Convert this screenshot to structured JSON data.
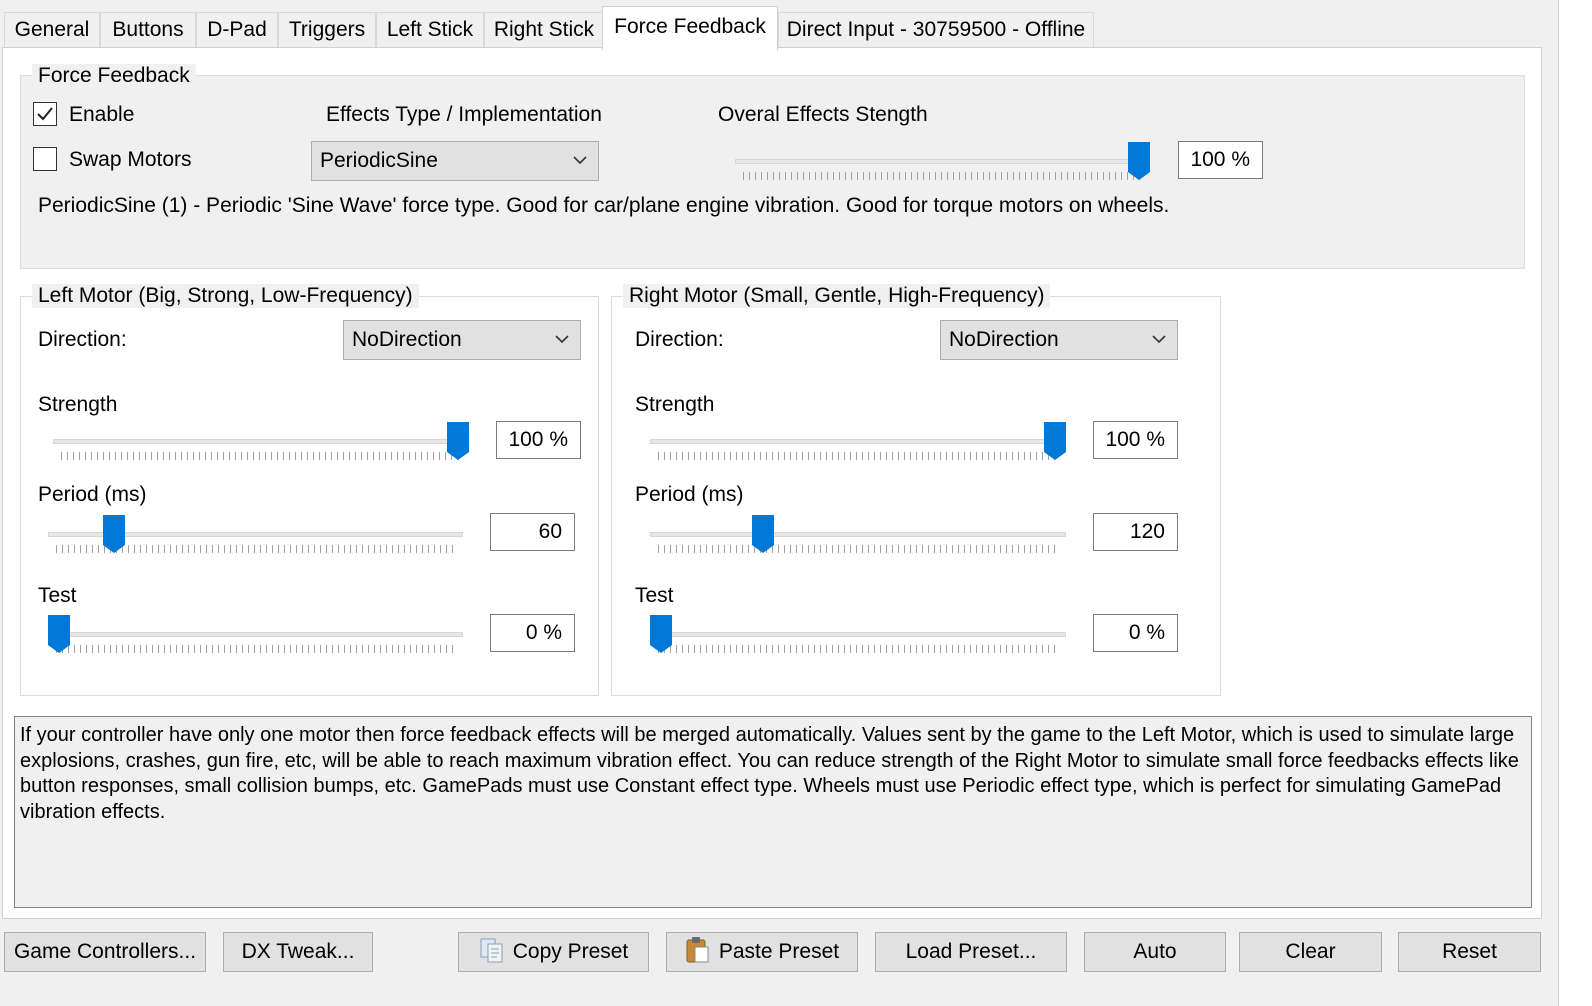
{
  "tabs": [
    {
      "label": "General"
    },
    {
      "label": "Buttons"
    },
    {
      "label": "D-Pad"
    },
    {
      "label": "Triggers"
    },
    {
      "label": "Left Stick"
    },
    {
      "label": "Right Stick"
    },
    {
      "label": "Force Feedback",
      "active": true
    },
    {
      "label": "Direct Input - 30759500 - Offline"
    }
  ],
  "force_feedback": {
    "group_title": "Force Feedback",
    "enable_label": "Enable",
    "enable_checked": true,
    "swap_label": "Swap Motors",
    "swap_checked": false,
    "effects_label": "Effects Type / Implementation",
    "effects_value": "PeriodicSine",
    "strength_label": "Overal Effects Stength",
    "strength_value": "100 %",
    "strength_level": 100,
    "description": "PeriodicSine (1) - Periodic 'Sine Wave' force type. Good for car/plane engine vibration. Good for torque motors on wheels."
  },
  "left_motor": {
    "title": "Left Motor (Big, Strong, Low-Frequency)",
    "direction_label": "Direction:",
    "direction_value": "NoDirection",
    "strength_label": "Strength",
    "strength_value": "100 %",
    "strength_level": 100,
    "period_label": "Period (ms)",
    "period_value": "60",
    "period_level": 14,
    "test_label": "Test",
    "test_value": "0 %",
    "test_level": 0
  },
  "right_motor": {
    "title": "Right Motor (Small, Gentle, High-Frequency)",
    "direction_label": "Direction:",
    "direction_value": "NoDirection",
    "strength_label": "Strength",
    "strength_value": "100 %",
    "strength_level": 100,
    "period_label": "Period (ms)",
    "period_value": "120",
    "period_level": 26,
    "test_label": "Test",
    "test_value": "0 %",
    "test_level": 0
  },
  "help_text": "If your controller have only one motor then force feedback effects will be merged automatically. Values sent by the game to the Left Motor, which is used to simulate large explosions, crashes, gun fire, etc, will be able to reach maximum vibration effect. You can reduce strength of the Right Motor to simulate small force feedbacks effects like button responses, small collision bumps, etc. GamePads must use Constant effect type. Wheels must use Periodic effect type, which is perfect for simulating GamePad vibration effects.",
  "buttons": {
    "game_controllers": "Game Controllers...",
    "dx_tweak": "DX Tweak...",
    "copy_preset": "Copy Preset",
    "paste_preset": "Paste Preset",
    "load_preset": "Load Preset...",
    "auto": "Auto",
    "clear": "Clear",
    "reset": "Reset"
  },
  "colors": {
    "accent": "#0078d7",
    "window_bg": "#f0f0f0",
    "page_bg": "#ffffff"
  }
}
